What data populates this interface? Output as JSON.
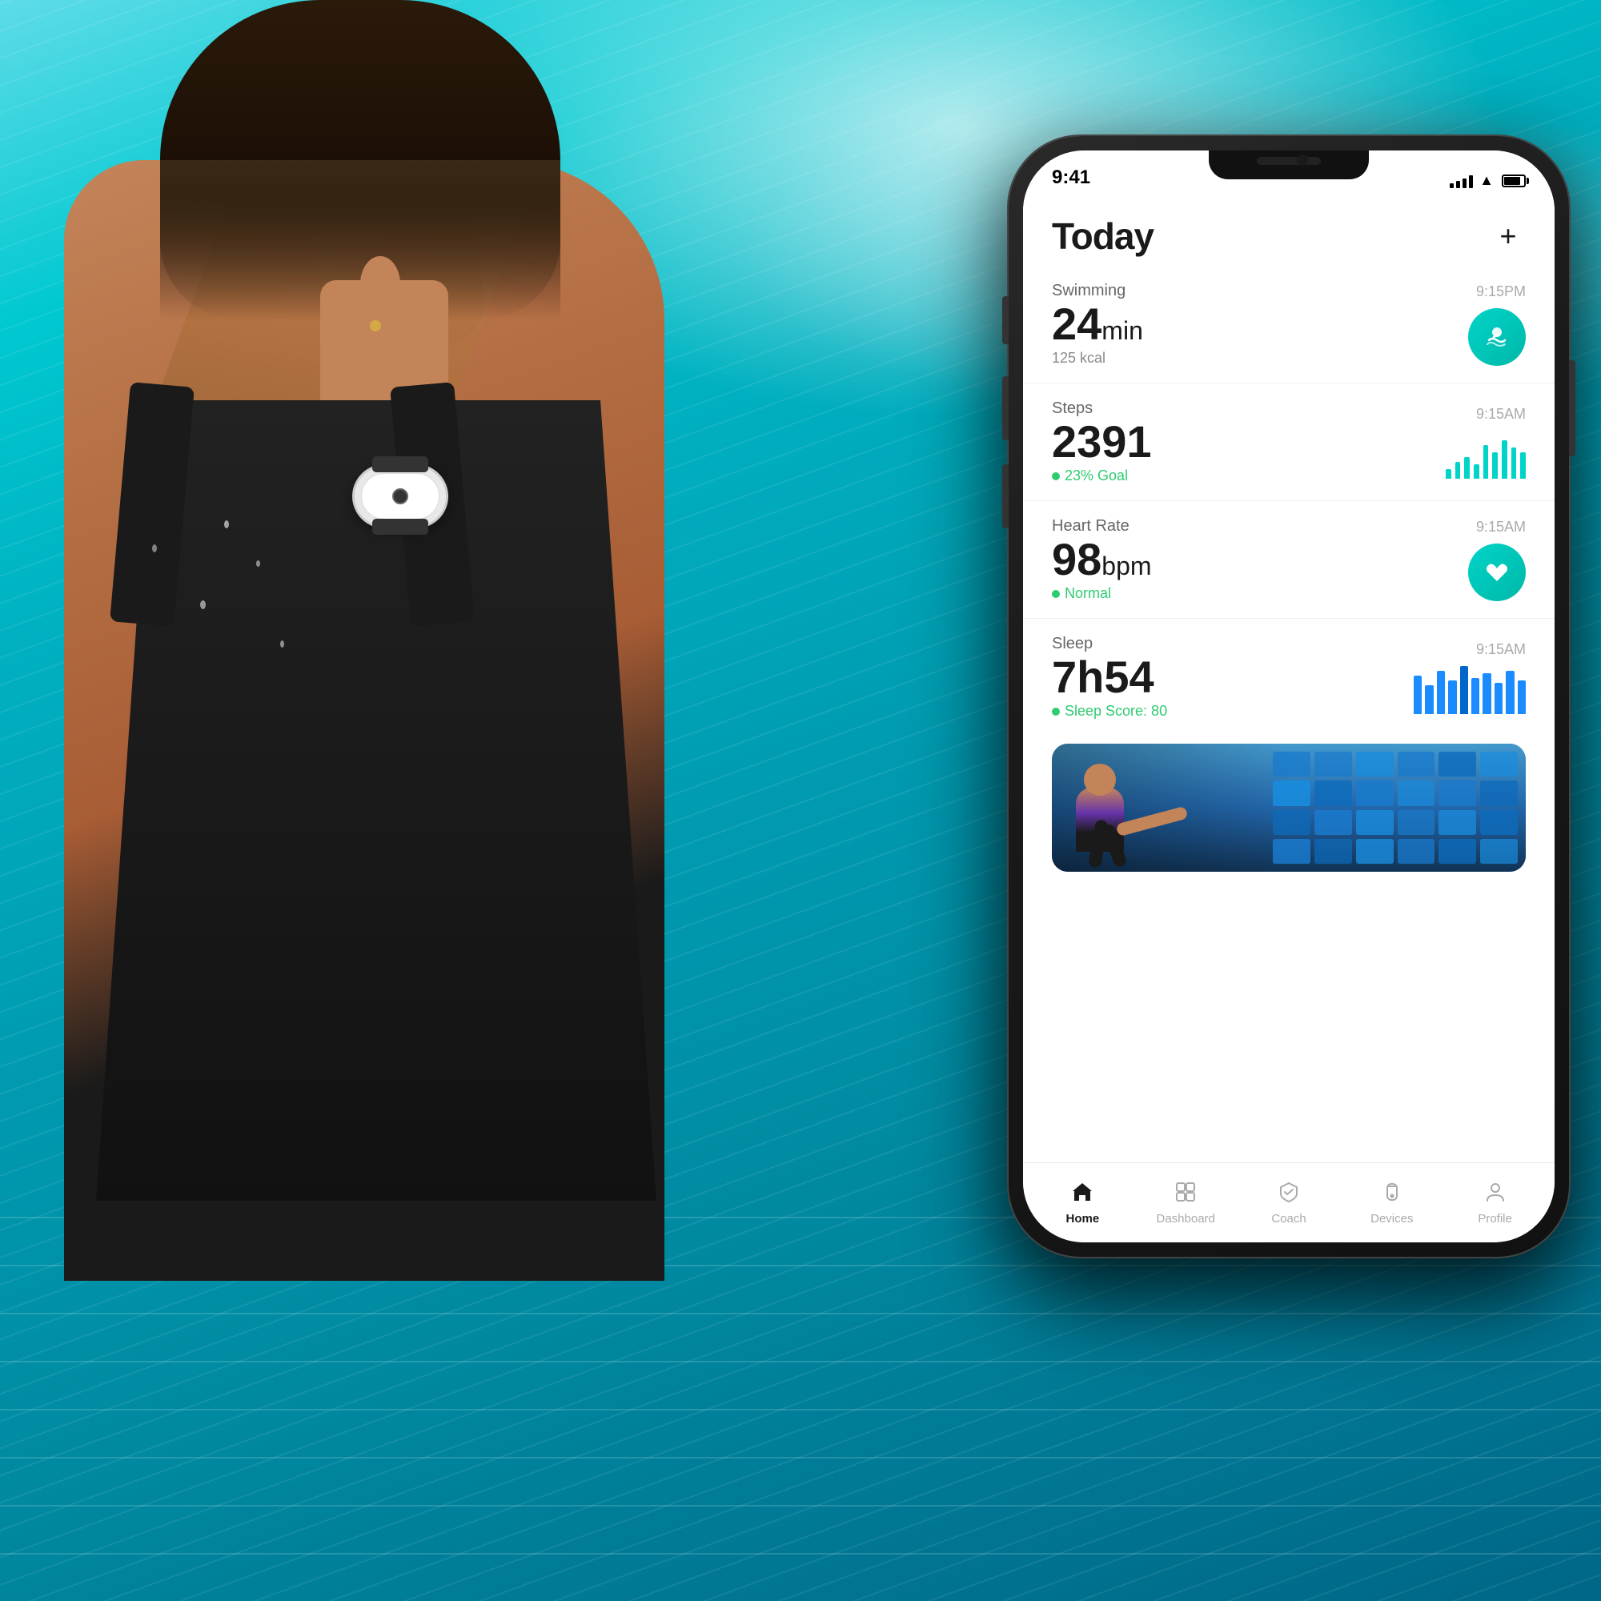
{
  "background": {
    "description": "Swimming pool with woman wearing smartwatch"
  },
  "phone": {
    "status_bar": {
      "time": "9:41"
    },
    "header": {
      "title": "Today",
      "add_button": "+"
    },
    "activities": [
      {
        "id": "swimming",
        "type": "Swimming",
        "value": "24",
        "unit": "min",
        "sub": "125 kcal",
        "time": "9:15PM",
        "icon": "🏊",
        "icon_type": "circle",
        "icon_color": "#00d4c8"
      },
      {
        "id": "steps",
        "type": "Steps",
        "value": "2391",
        "unit": "",
        "sub": "23% Goal",
        "time": "9:15AM",
        "icon": "chart",
        "icon_type": "bar_chart"
      },
      {
        "id": "heart_rate",
        "type": "Heart Rate",
        "value": "98",
        "unit": "bpm",
        "sub": "Normal",
        "time": "9:15AM",
        "icon": "♥",
        "icon_type": "circle",
        "icon_color": "#00d4c8"
      },
      {
        "id": "sleep",
        "type": "Sleep",
        "value": "7h54",
        "unit": "",
        "sub": "Sleep Score: 80",
        "time": "9:15AM",
        "icon": "chart",
        "icon_type": "sleep_chart"
      }
    ],
    "steps_chart_bars": [
      20,
      35,
      45,
      30,
      55,
      40,
      60,
      50,
      45
    ],
    "sleep_chart_bars": [
      80,
      60,
      90,
      70,
      85,
      65,
      80,
      75,
      90,
      70
    ],
    "bottom_nav": [
      {
        "id": "home",
        "label": "Home",
        "icon": "home",
        "active": true
      },
      {
        "id": "dashboard",
        "label": "Dashboard",
        "icon": "dashboard",
        "active": false
      },
      {
        "id": "coach",
        "label": "Coach",
        "icon": "coach",
        "active": false
      },
      {
        "id": "devices",
        "label": "Devices",
        "icon": "devices",
        "active": false
      },
      {
        "id": "profile",
        "label": "Profile",
        "icon": "profile",
        "active": false
      }
    ]
  }
}
